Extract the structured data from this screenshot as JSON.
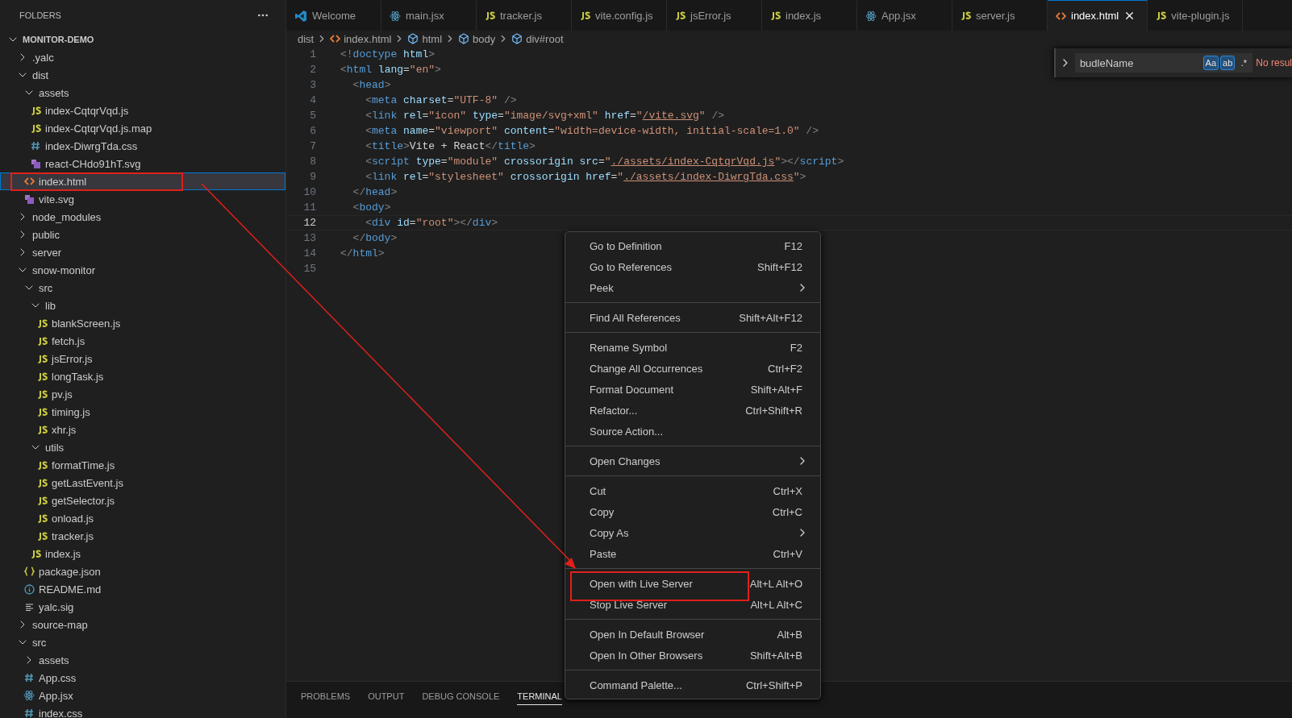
{
  "sidebar": {
    "title": "FOLDERS",
    "tree": {
      "name": "MONITOR-DEMO",
      "kind": "folder",
      "expanded": true,
      "selected": false,
      "children": [
        {
          "name": ".yalc",
          "kind": "folder",
          "expanded": false,
          "selected": false
        },
        {
          "name": "dist",
          "kind": "folder",
          "expanded": true,
          "selected": false,
          "children": [
            {
              "name": "assets",
              "kind": "folder",
              "expanded": true,
              "selected": false,
              "children": [
                {
                  "name": "index-CqtqrVqd.js",
                  "kind": "js",
                  "selected": false
                },
                {
                  "name": "index-CqtqrVqd.js.map",
                  "kind": "js",
                  "selected": false
                },
                {
                  "name": "index-DiwrgTda.css",
                  "kind": "css",
                  "selected": false
                },
                {
                  "name": "react-CHdo91hT.svg",
                  "kind": "svg",
                  "selected": false
                }
              ]
            },
            {
              "name": "index.html",
              "kind": "html",
              "selected": true
            },
            {
              "name": "vite.svg",
              "kind": "svg",
              "selected": false
            }
          ]
        },
        {
          "name": "node_modules",
          "kind": "folder",
          "expanded": false,
          "selected": false
        },
        {
          "name": "public",
          "kind": "folder",
          "expanded": false,
          "selected": false
        },
        {
          "name": "server",
          "kind": "folder",
          "expanded": false,
          "selected": false
        },
        {
          "name": "snow-monitor",
          "kind": "folder",
          "expanded": true,
          "selected": false,
          "children": [
            {
              "name": "src",
              "kind": "folder",
              "expanded": true,
              "selected": false,
              "children": [
                {
                  "name": "lib",
                  "kind": "folder",
                  "expanded": true,
                  "selected": false,
                  "children": [
                    {
                      "name": "blankScreen.js",
                      "kind": "js",
                      "selected": false
                    },
                    {
                      "name": "fetch.js",
                      "kind": "js",
                      "selected": false
                    },
                    {
                      "name": "jsError.js",
                      "kind": "js",
                      "selected": false
                    },
                    {
                      "name": "longTask.js",
                      "kind": "js",
                      "selected": false
                    },
                    {
                      "name": "pv.js",
                      "kind": "js",
                      "selected": false
                    },
                    {
                      "name": "timing.js",
                      "kind": "js",
                      "selected": false
                    },
                    {
                      "name": "xhr.js",
                      "kind": "js",
                      "selected": false
                    }
                  ]
                },
                {
                  "name": "utils",
                  "kind": "folder",
                  "expanded": true,
                  "selected": false,
                  "children": [
                    {
                      "name": "formatTime.js",
                      "kind": "js",
                      "selected": false
                    },
                    {
                      "name": "getLastEvent.js",
                      "kind": "js",
                      "selected": false
                    },
                    {
                      "name": "getSelector.js",
                      "kind": "js",
                      "selected": false
                    },
                    {
                      "name": "onload.js",
                      "kind": "js",
                      "selected": false
                    },
                    {
                      "name": "tracker.js",
                      "kind": "js",
                      "selected": false
                    }
                  ]
                },
                {
                  "name": "index.js",
                  "kind": "js",
                  "selected": false
                }
              ]
            },
            {
              "name": "package.json",
              "kind": "json",
              "selected": false
            },
            {
              "name": "README.md",
              "kind": "info",
              "selected": false
            },
            {
              "name": "yalc.sig",
              "kind": "text",
              "selected": false
            }
          ]
        },
        {
          "name": "source-map",
          "kind": "folder",
          "expanded": false,
          "selected": false
        },
        {
          "name": "src",
          "kind": "folder",
          "expanded": true,
          "selected": false,
          "children": [
            {
              "name": "assets",
              "kind": "folder",
              "expanded": false,
              "selected": false
            },
            {
              "name": "App.css",
              "kind": "css",
              "selected": false
            },
            {
              "name": "App.jsx",
              "kind": "react",
              "selected": false
            },
            {
              "name": "index.css",
              "kind": "css",
              "selected": false
            }
          ]
        }
      ]
    }
  },
  "tabs": [
    {
      "label": "Welcome",
      "kind": "vscode",
      "selected": false
    },
    {
      "label": "main.jsx",
      "kind": "react",
      "selected": false
    },
    {
      "label": "tracker.js",
      "kind": "js",
      "selected": false
    },
    {
      "label": "vite.config.js",
      "kind": "js",
      "selected": false
    },
    {
      "label": "jsError.js",
      "kind": "js",
      "selected": false
    },
    {
      "label": "index.js",
      "kind": "js",
      "selected": false
    },
    {
      "label": "App.jsx",
      "kind": "react",
      "selected": false
    },
    {
      "label": "server.js",
      "kind": "js",
      "selected": false
    },
    {
      "label": "index.html",
      "kind": "html",
      "selected": true
    },
    {
      "label": "vite-plugin.js",
      "kind": "js",
      "selected": false
    }
  ],
  "breadcrumb": [
    {
      "label": "dist",
      "kind": "folder"
    },
    {
      "label": "index.html",
      "kind": "html"
    },
    {
      "label": "html",
      "kind": "element"
    },
    {
      "label": "body",
      "kind": "element"
    },
    {
      "label": "div#root",
      "kind": "element"
    }
  ],
  "editor": {
    "lines": [
      {
        "number": "1",
        "current": false,
        "tokens": [
          {
            "text": "<!",
            "kind": "p"
          },
          {
            "text": "doctype",
            "kind": "t"
          },
          {
            "text": " html",
            "kind": "a"
          },
          {
            "text": ">",
            "kind": "p"
          }
        ]
      },
      {
        "number": "2",
        "current": false,
        "tokens": [
          {
            "text": "<",
            "kind": "p"
          },
          {
            "text": "html",
            "kind": "t"
          },
          {
            "text": " lang",
            "kind": "a"
          },
          {
            "text": "=",
            "kind": "x"
          },
          {
            "text": "\"en\"",
            "kind": "s"
          },
          {
            "text": ">",
            "kind": "p"
          }
        ]
      },
      {
        "number": "3",
        "current": false,
        "tokens": [
          {
            "text": "  <",
            "kind": "p"
          },
          {
            "text": "head",
            "kind": "t"
          },
          {
            "text": ">",
            "kind": "p"
          }
        ]
      },
      {
        "number": "4",
        "current": false,
        "tokens": [
          {
            "text": "    <",
            "kind": "p"
          },
          {
            "text": "meta",
            "kind": "t"
          },
          {
            "text": " charset",
            "kind": "a"
          },
          {
            "text": "=",
            "kind": "x"
          },
          {
            "text": "\"UTF-8\"",
            "kind": "s"
          },
          {
            "text": " />",
            "kind": "p"
          }
        ]
      },
      {
        "number": "5",
        "current": false,
        "tokens": [
          {
            "text": "    <",
            "kind": "p"
          },
          {
            "text": "link",
            "kind": "t"
          },
          {
            "text": " rel",
            "kind": "a"
          },
          {
            "text": "=",
            "kind": "x"
          },
          {
            "text": "\"icon\"",
            "kind": "s"
          },
          {
            "text": " type",
            "kind": "a"
          },
          {
            "text": "=",
            "kind": "x"
          },
          {
            "text": "\"image/svg+xml\"",
            "kind": "s"
          },
          {
            "text": " href",
            "kind": "a"
          },
          {
            "text": "=",
            "kind": "x"
          },
          {
            "text": "\"",
            "kind": "s"
          },
          {
            "text": "/vite.svg",
            "kind": "u"
          },
          {
            "text": "\"",
            "kind": "s"
          },
          {
            "text": " />",
            "kind": "p"
          }
        ]
      },
      {
        "number": "6",
        "current": false,
        "tokens": [
          {
            "text": "    <",
            "kind": "p"
          },
          {
            "text": "meta",
            "kind": "t"
          },
          {
            "text": " name",
            "kind": "a"
          },
          {
            "text": "=",
            "kind": "x"
          },
          {
            "text": "\"viewport\"",
            "kind": "s"
          },
          {
            "text": " content",
            "kind": "a"
          },
          {
            "text": "=",
            "kind": "x"
          },
          {
            "text": "\"width=device-width, initial-scale=1.0\"",
            "kind": "s"
          },
          {
            "text": " />",
            "kind": "p"
          }
        ]
      },
      {
        "number": "7",
        "current": false,
        "tokens": [
          {
            "text": "    <",
            "kind": "p"
          },
          {
            "text": "title",
            "kind": "t"
          },
          {
            "text": ">",
            "kind": "p"
          },
          {
            "text": "Vite + React",
            "kind": "x"
          },
          {
            "text": "</",
            "kind": "p"
          },
          {
            "text": "title",
            "kind": "t"
          },
          {
            "text": ">",
            "kind": "p"
          }
        ]
      },
      {
        "number": "8",
        "current": false,
        "tokens": [
          {
            "text": "    <",
            "kind": "p"
          },
          {
            "text": "script",
            "kind": "t"
          },
          {
            "text": " type",
            "kind": "a"
          },
          {
            "text": "=",
            "kind": "x"
          },
          {
            "text": "\"module\"",
            "kind": "s"
          },
          {
            "text": " crossorigin src",
            "kind": "a"
          },
          {
            "text": "=",
            "kind": "x"
          },
          {
            "text": "\"",
            "kind": "s"
          },
          {
            "text": "./assets/index-CqtqrVqd.js",
            "kind": "u"
          },
          {
            "text": "\"",
            "kind": "s"
          },
          {
            "text": "></",
            "kind": "p"
          },
          {
            "text": "script",
            "kind": "t"
          },
          {
            "text": ">",
            "kind": "p"
          }
        ]
      },
      {
        "number": "9",
        "current": false,
        "tokens": [
          {
            "text": "    <",
            "kind": "p"
          },
          {
            "text": "link",
            "kind": "t"
          },
          {
            "text": " rel",
            "kind": "a"
          },
          {
            "text": "=",
            "kind": "x"
          },
          {
            "text": "\"stylesheet\"",
            "kind": "s"
          },
          {
            "text": " crossorigin href",
            "kind": "a"
          },
          {
            "text": "=",
            "kind": "x"
          },
          {
            "text": "\"",
            "kind": "s"
          },
          {
            "text": "./assets/index-DiwrgTda.css",
            "kind": "u"
          },
          {
            "text": "\"",
            "kind": "s"
          },
          {
            "text": ">",
            "kind": "p"
          }
        ]
      },
      {
        "number": "10",
        "current": false,
        "tokens": [
          {
            "text": "  </",
            "kind": "p"
          },
          {
            "text": "head",
            "kind": "t"
          },
          {
            "text": ">",
            "kind": "p"
          }
        ]
      },
      {
        "number": "11",
        "current": false,
        "tokens": [
          {
            "text": "  <",
            "kind": "p"
          },
          {
            "text": "body",
            "kind": "t"
          },
          {
            "text": ">",
            "kind": "p"
          }
        ]
      },
      {
        "number": "12",
        "current": true,
        "tokens": [
          {
            "text": "    <",
            "kind": "p"
          },
          {
            "text": "div",
            "kind": "t"
          },
          {
            "text": " id",
            "kind": "a"
          },
          {
            "text": "=",
            "kind": "x"
          },
          {
            "text": "\"root\"",
            "kind": "s"
          },
          {
            "text": "></",
            "kind": "p"
          },
          {
            "text": "div",
            "kind": "t"
          },
          {
            "text": ">",
            "kind": "p"
          }
        ]
      },
      {
        "number": "13",
        "current": false,
        "tokens": [
          {
            "text": "  </",
            "kind": "p"
          },
          {
            "text": "body",
            "kind": "t"
          },
          {
            "text": ">",
            "kind": "p"
          }
        ]
      },
      {
        "number": "14",
        "current": false,
        "tokens": [
          {
            "text": "</",
            "kind": "p"
          },
          {
            "text": "html",
            "kind": "t"
          },
          {
            "text": ">",
            "kind": "p"
          }
        ]
      },
      {
        "number": "15",
        "current": false
      }
    ]
  },
  "find_widget": {
    "query": "budleName",
    "toggles": [
      {
        "label": "Aa",
        "on": true
      },
      {
        "label": "ab",
        "on": true
      },
      {
        "label": ".*",
        "on": false
      }
    ],
    "status": "No resul"
  },
  "context_menu": {
    "groups": [
      {
        "items": [
          {
            "label": "Go to Definition",
            "shortcut": "F12",
            "submenu": false
          },
          {
            "label": "Go to References",
            "shortcut": "Shift+F12",
            "submenu": false
          },
          {
            "label": "Peek",
            "submenu": true
          }
        ]
      },
      {
        "items": [
          {
            "label": "Find All References",
            "shortcut": "Shift+Alt+F12",
            "submenu": false
          }
        ]
      },
      {
        "items": [
          {
            "label": "Rename Symbol",
            "shortcut": "F2",
            "submenu": false
          },
          {
            "label": "Change All Occurrences",
            "shortcut": "Ctrl+F2",
            "submenu": false
          },
          {
            "label": "Format Document",
            "shortcut": "Shift+Alt+F",
            "submenu": false
          },
          {
            "label": "Refactor...",
            "shortcut": "Ctrl+Shift+R",
            "submenu": false
          },
          {
            "label": "Source Action...",
            "submenu": false
          }
        ]
      },
      {
        "items": [
          {
            "label": "Open Changes",
            "submenu": true
          }
        ]
      },
      {
        "items": [
          {
            "label": "Cut",
            "shortcut": "Ctrl+X",
            "submenu": false
          },
          {
            "label": "Copy",
            "shortcut": "Ctrl+C",
            "submenu": false
          },
          {
            "label": "Copy As",
            "submenu": true
          },
          {
            "label": "Paste",
            "shortcut": "Ctrl+V",
            "submenu": false
          }
        ]
      },
      {
        "items": [
          {
            "label": "Open with Live Server",
            "shortcut": "Alt+L Alt+O",
            "submenu": false
          },
          {
            "label": "Stop Live Server",
            "shortcut": "Alt+L Alt+C",
            "submenu": false
          }
        ]
      },
      {
        "items": [
          {
            "label": "Open In Default Browser",
            "shortcut": "Alt+B",
            "submenu": false
          },
          {
            "label": "Open In Other Browsers",
            "shortcut": "Shift+Alt+B",
            "submenu": false
          }
        ]
      },
      {
        "items": [
          {
            "label": "Command Palette...",
            "shortcut": "Ctrl+Shift+P",
            "submenu": false
          }
        ]
      }
    ]
  },
  "panel": {
    "tabs": [
      {
        "label": "PROBLEMS",
        "selected": false
      },
      {
        "label": "OUTPUT",
        "selected": false
      },
      {
        "label": "DEBUG CONSOLE",
        "selected": false
      },
      {
        "label": "TERMINAL",
        "selected": true
      }
    ]
  }
}
